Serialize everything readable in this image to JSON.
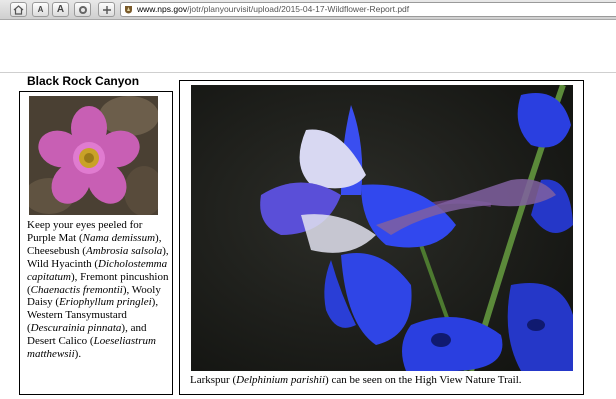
{
  "browser": {
    "buttons": {
      "small_text_label": "A",
      "large_text_label": "A"
    },
    "url": {
      "host": "www.nps.gov",
      "path": "/jotr/planyourvisit/upload/2015-04-17-Wildflower-Report.pdf"
    },
    "icons": [
      "home-icon",
      "stop-icon",
      "add-icon",
      "favicon-icon"
    ]
  },
  "document": {
    "section_title": "Black Rock Canyon",
    "left_panel": {
      "photo_subject": "Purple Mat",
      "paragraph": [
        {
          "text": "Keep your eyes peeled for Purple Mat ("
        },
        {
          "text": "Nama demissum",
          "italic": true
        },
        {
          "text": "), Cheesebush ("
        },
        {
          "text": "Ambrosia salsola",
          "italic": true
        },
        {
          "text": "), Wild Hyacinth ("
        },
        {
          "text": "Dicholostemma capitatum",
          "italic": true
        },
        {
          "text": "), Fremont pincushion ("
        },
        {
          "text": "Chaenactis fremontii",
          "italic": true
        },
        {
          "text": "), Wooly Daisy ("
        },
        {
          "text": "Eriophyllum pringlei",
          "italic": true
        },
        {
          "text": "), Western Tansymustard ("
        },
        {
          "text": "Descurainia pinnata",
          "italic": true
        },
        {
          "text": "), and Desert Calico ("
        },
        {
          "text": "Loeseliastrum matthewsii",
          "italic": true
        },
        {
          "text": ")."
        }
      ]
    },
    "right_panel": {
      "photo_subject": "Larkspur",
      "caption_before": "Larkspur (",
      "caption_italic": "Delphinium parishii",
      "caption_after": ") can be seen on the High View Nature Trail."
    }
  },
  "colors": {
    "toolbar": "#d9d9d9",
    "purple_mat_petal": "#c85fb4",
    "flower_center": "#c9a227",
    "larkspur_blue": "#2a3fe0",
    "photo_background": "#1e1f1c"
  }
}
